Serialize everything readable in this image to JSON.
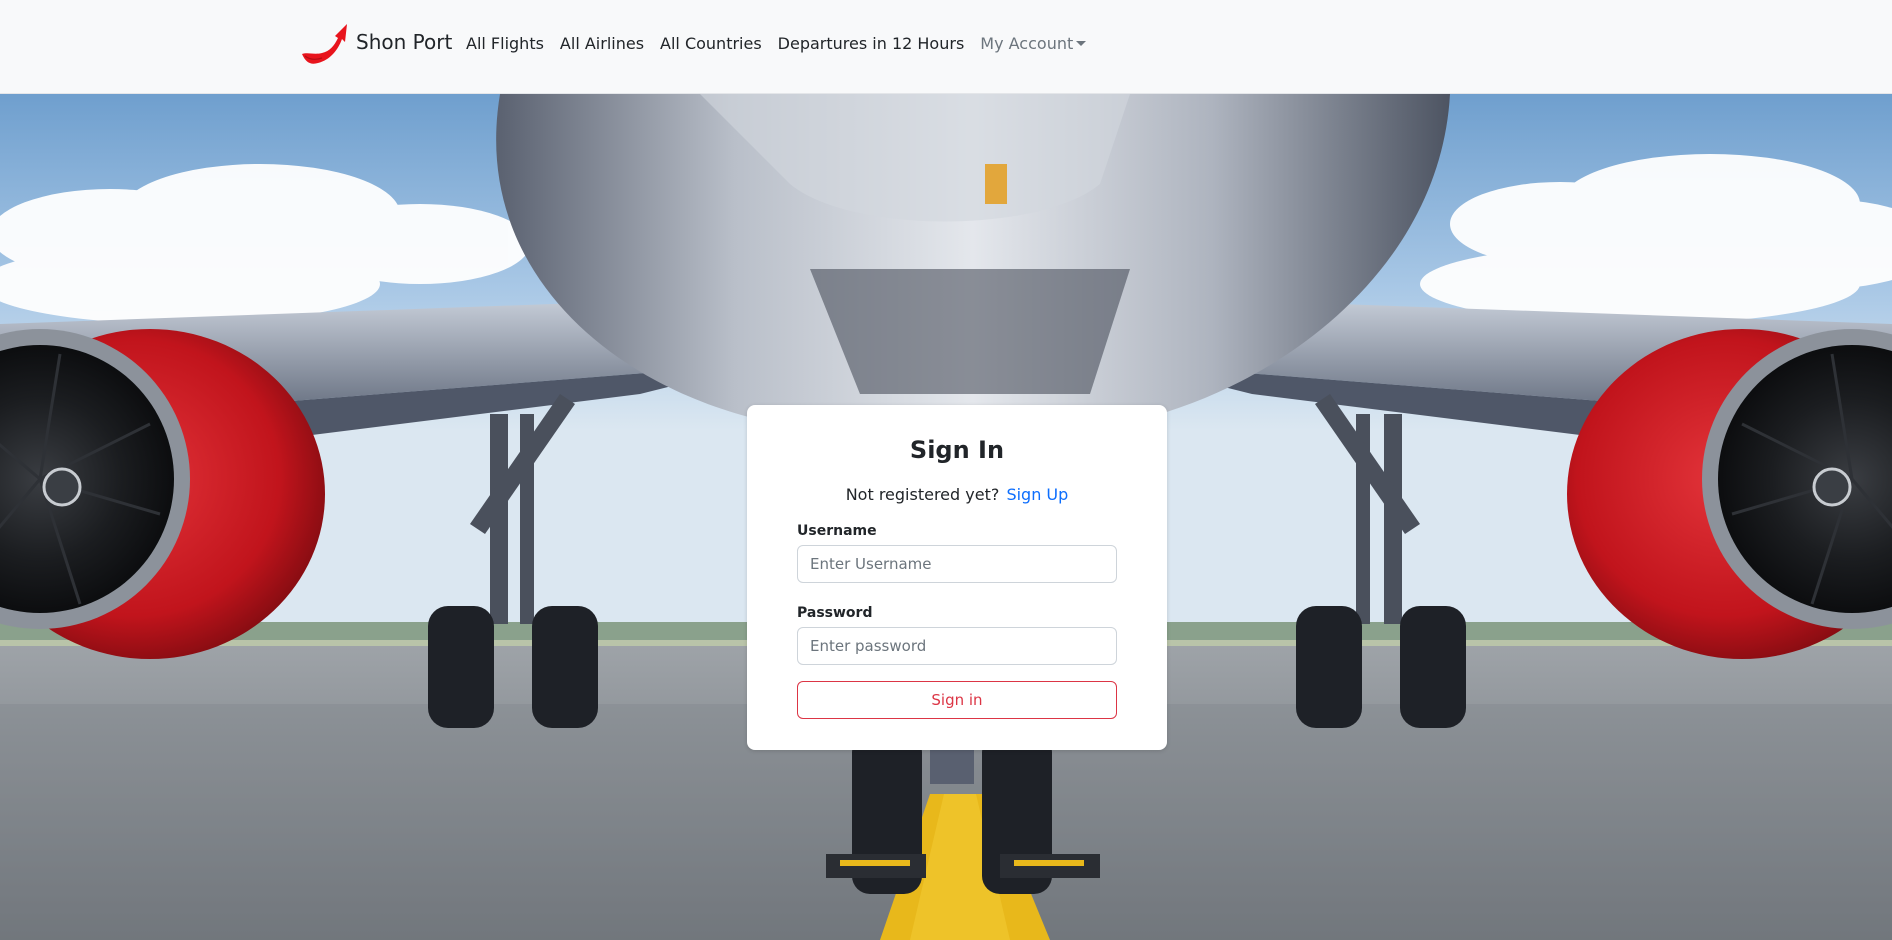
{
  "navbar": {
    "brand": "Shon Port",
    "links": [
      {
        "label": "All Flights"
      },
      {
        "label": "All Airlines"
      },
      {
        "label": "All Countries"
      },
      {
        "label": "Departures in 12 Hours"
      }
    ],
    "account_menu": {
      "label": "My Account"
    }
  },
  "signin": {
    "title": "Sign In",
    "register_prompt": "Not registered yet?",
    "register_link": "Sign Up",
    "username_label": "Username",
    "username_placeholder": "Enter Username",
    "username_value": "",
    "password_label": "Password",
    "password_placeholder": "Enter password",
    "password_value": "",
    "submit_label": "Sign in"
  },
  "colors": {
    "brand_red": "#e8141c",
    "link_blue": "#0d6efd",
    "danger_red": "#dc3545",
    "navbar_bg": "#f8f9fa"
  },
  "icons": {
    "brand_logo": "plane-swoosh-logo-icon",
    "account_dropdown": "caret-down-icon"
  }
}
